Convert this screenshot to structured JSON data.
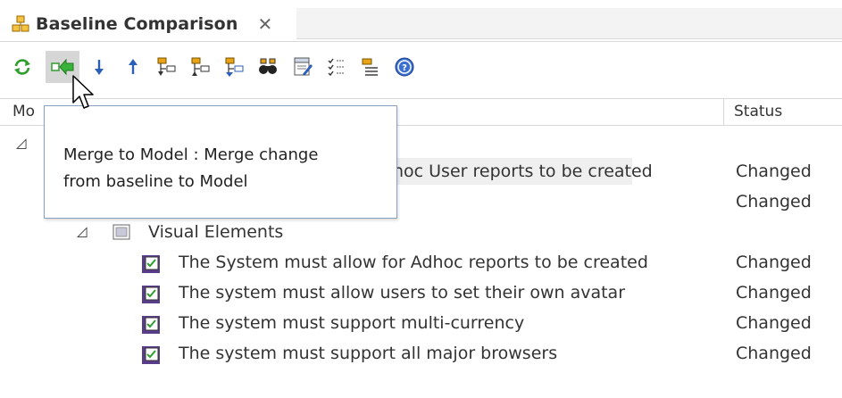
{
  "tab": {
    "title": "Baseline Comparison",
    "close_glyph": "✕"
  },
  "toolbar": {
    "buttons": [
      {
        "name": "refresh-icon"
      },
      {
        "name": "merge-to-model-icon"
      },
      {
        "name": "arrow-down-icon"
      },
      {
        "name": "arrow-up-icon"
      },
      {
        "name": "tree-expand-icon"
      },
      {
        "name": "tree-collapse-icon"
      },
      {
        "name": "tree-filter-icon"
      },
      {
        "name": "binoculars-icon"
      },
      {
        "name": "xml-report-icon"
      },
      {
        "name": "checklist-icon"
      },
      {
        "name": "document-list-icon"
      },
      {
        "name": "help-icon"
      }
    ]
  },
  "table": {
    "col_model": "Mo",
    "col_status": "Status"
  },
  "rows": {
    "partial_label": "hoc User reports to be created",
    "partial_status": "Changed",
    "row2_status": "Changed",
    "visual_elements": "Visual Elements",
    "items": [
      {
        "label": "The System must allow for Adhoc reports to be created",
        "status": "Changed"
      },
      {
        "label": "The system must allow users to set their own avatar",
        "status": "Changed"
      },
      {
        "label": "The system must support multi-currency",
        "status": "Changed"
      },
      {
        "label": "The system must support all major browsers",
        "status": "Changed"
      }
    ]
  },
  "tooltip": {
    "line1": "Merge to Model : Merge change",
    "line2": "from baseline to Model"
  },
  "colors": {
    "accent_green": "#2f9e2f",
    "accent_blue": "#2b5fb8",
    "folder_yellow": "#e8a317",
    "tooltip_border": "#8aa0c0"
  }
}
